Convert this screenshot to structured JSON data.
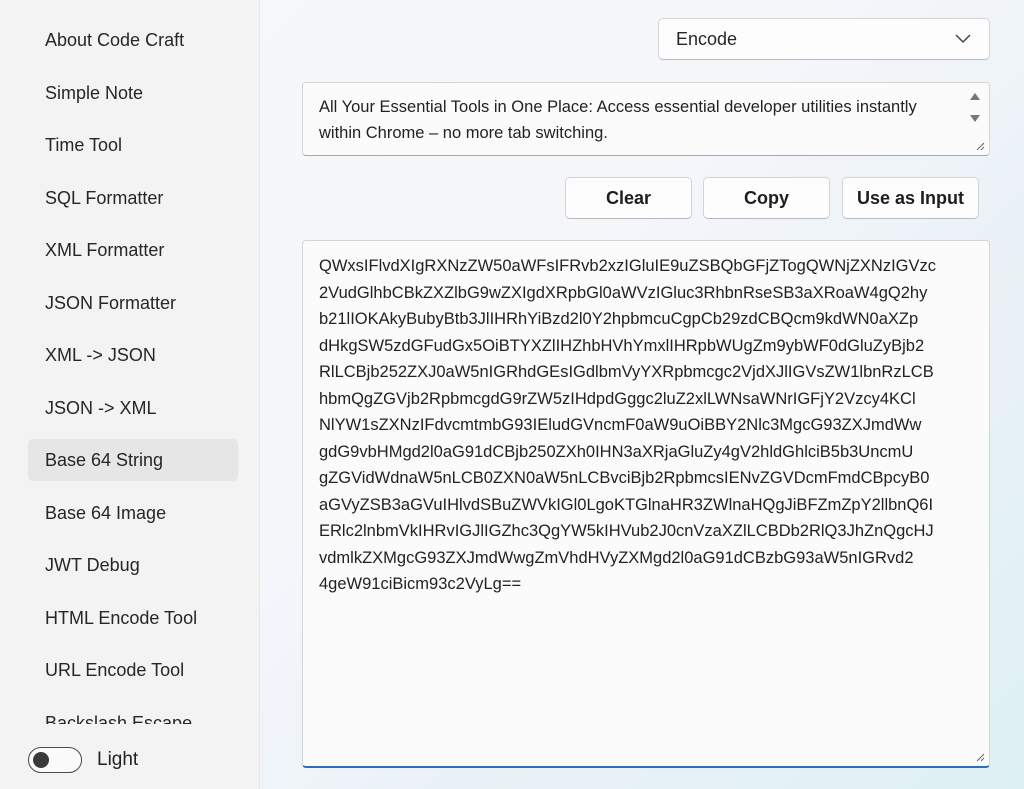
{
  "sidebar": {
    "items": [
      {
        "label": "About Code Craft"
      },
      {
        "label": "Simple Note"
      },
      {
        "label": "Time Tool"
      },
      {
        "label": "SQL Formatter"
      },
      {
        "label": "XML Formatter"
      },
      {
        "label": "JSON Formatter"
      },
      {
        "label": "XML -> JSON"
      },
      {
        "label": "JSON -> XML"
      },
      {
        "label": "Base 64 String"
      },
      {
        "label": "Base 64 Image"
      },
      {
        "label": "JWT Debug"
      },
      {
        "label": "HTML Encode Tool"
      },
      {
        "label": "URL Encode Tool"
      },
      {
        "label": "Backslash Escape"
      }
    ],
    "active_item": "Base 64 String",
    "theme_toggle": {
      "label": "Light",
      "on": false
    }
  },
  "mode_select": {
    "value": "Encode"
  },
  "input": {
    "value": "All Your Essential Tools in One Place: Access essential developer utilities instantly within Chrome – no more tab switching."
  },
  "buttons": {
    "clear": "Clear",
    "copy": "Copy",
    "use_as_input": "Use as Input"
  },
  "output": {
    "lines": [
      "QWxsIFlvdXIgRXNzZW50aWFsIFRvb2xzIGluIE9uZSBQbGFjZTogQWNjZXNzIGVzc",
      "2VudGlhbCBkZXZlbG9wZXIgdXRpbGl0aWVzIGluc3RhbnRseSB3aXRoaW4gQ2hy",
      "b21lIOKAkyBubyBtb3JlIHRhYiBzd2l0Y2hpbmcuCgpCb29zdCBQcm9kdWN0aXZp",
      "dHkgSW5zdGFudGx5OiBTYXZlIHZhbHVhYmxlIHRpbWUgZm9ybWF0dGluZyBjb2",
      "RlLCBjb252ZXJ0aW5nIGRhdGEsIGdlbmVyYXRpbmcgc2VjdXJlIGVsZW1lbnRzLCB",
      "hbmQgZGVjb2RpbmcgdG9rZW5zIHdpdGggc2luZ2xlLWNsaWNrIGFjY2Vzcy4KCl",
      "NlYW1sZXNzIFdvcmtmbG93IEludGVncmF0aW9uOiBBY2Nlc3MgcG93ZXJmdWw",
      "gdG9vbHMgd2l0aG91dCBjb250ZXh0IHN3aXRjaGluZy4gV2hldGhlciB5b3UncmU",
      "gZGVidWdnaW5nLCB0ZXN0aW5nLCBvciBjb2RpbmcsIENvZGVDcmFmdCBpcyB0",
      "aGVyZSB3aGVuIHlvdSBuZWVkIGl0LgoKTGlnaHR3ZWlnaHQgJiBFZmZpY2llbnQ6I",
      "ERlc2lnbmVkIHRvIGJlIGZhc3QgYW5kIHVub2J0cnVzaXZlLCBDb2RlQ3JhZnQgcHJ",
      "vdmlkZXMgcG93ZXJmdWwgZmVhdHVyZXMgd2l0aG91dCBzbG93aW5nIGRvd2",
      "4geW91ciBicm93c2VyLg=="
    ]
  }
}
